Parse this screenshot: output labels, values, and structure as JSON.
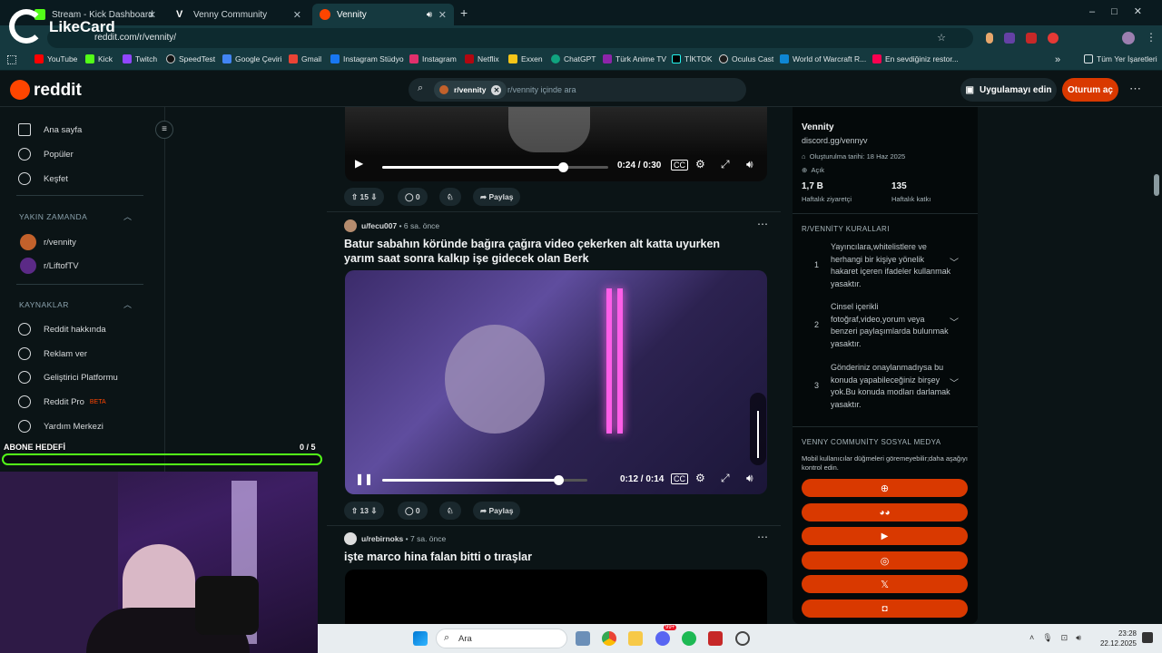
{
  "browser": {
    "tabs": [
      {
        "label": "Stream - Kick Dashboard",
        "color": "#53fc18"
      },
      {
        "label": "Venny Community",
        "color": "#ffffff"
      },
      {
        "label": "Vennity",
        "color": "#ff4500"
      }
    ],
    "url": "reddit.com/r/vennity/",
    "overlay_logo": "LikeCard",
    "bookmarks": [
      "YouTube",
      "Kick",
      "Twitch",
      "SpeedTest",
      "Google Çeviri",
      "Gmail",
      "Instagram Stüdyo",
      "Instagram",
      "Netflix",
      "Exxen",
      "ChatGPT",
      "Türk Anime TV",
      "TİKTOK",
      "Oculus Cast",
      "World of Warcraft R...",
      "En sevdiğiniz restor..."
    ],
    "bookmarks_folder": "Tüm Yer İşaretleri"
  },
  "reddit": {
    "logo": "reddit",
    "search_chip": "r/vennity",
    "search_placeholder": "r/vennity içinde ara",
    "get_app": "Uygulamayı edin",
    "login": "Oturum aç"
  },
  "leftnav": {
    "items": [
      "Ana sayfa",
      "Popüler",
      "Keşfet"
    ],
    "recent_title": "YAKIN ZAMANDA",
    "recent": [
      "r/vennity",
      "r/LiftofTV"
    ],
    "resources_title": "KAYNAKLAR",
    "resources": [
      "Reddit hakkında",
      "Reklam ver",
      "Geliştirici Platformu",
      "Reddit Pro",
      "Yardım Merkezi"
    ],
    "beta": "BETA"
  },
  "posts": [
    {
      "time": "0:24 / 0:30",
      "progress": 0.8,
      "votes": "15",
      "comments": "0",
      "share": "Paylaş"
    },
    {
      "author": "u/fecu007",
      "age": "6 sa. önce",
      "title": "Batur sabahın köründe bağıra çağıra video çekerken alt katta uyurken yarım saat sonra kalkıp işe gidecek olan Berk",
      "time": "0:12 / 0:14",
      "progress": 0.86,
      "votes": "13",
      "comments": "0",
      "share": "Paylaş"
    },
    {
      "author": "u/rebirnoks",
      "age": "7 sa. önce",
      "title": "işte marco hina falan bitti o tıraşlar"
    }
  ],
  "sidebar": {
    "name": "Vennity",
    "discord": "discord.gg/vennyv",
    "created": "Oluşturulma tarihi: 18 Haz 2025",
    "status": "Açık",
    "visitors": "1,7 B",
    "visitors_label": "Haftalık ziyaretçi",
    "contrib": "135",
    "contrib_label": "Haftalık katkı",
    "rules_title": "R/VENNİTY KURALLARI",
    "rules": [
      {
        "n": "1",
        "text": "Yayıncılara,whitelistlere ve herhangi bir kişiye yönelik hakaret içeren ifadeler kullanmak yasaktır."
      },
      {
        "n": "2",
        "text": "Cinsel içerikli fotoğraf,video,yorum veya benzeri paylaşımlarda bulunmak yasaktır."
      },
      {
        "n": "3",
        "text": "Gönderiniz onaylanmadıysa bu konuda yapabileceğiniz birşey yok.Bu konuda modları darlamak yasaktır."
      }
    ],
    "social_title": "VENNY COMMUNİTY SOSYAL MEDYA",
    "social_note": "Mobil kullanıcılar düğmeleri göremeyebilir;daha aşağıyı kontrol edin.",
    "social_icons": [
      "globe-icon",
      "discord-icon",
      "youtube-icon",
      "instagram-icon",
      "x-icon",
      "twitch-icon"
    ]
  },
  "stream_overlay": {
    "goal_label": "ABONE HEDEFİ",
    "goal_value": "0 / 5",
    "goal_progress": 0
  },
  "taskbar": {
    "search": "Ara",
    "time": "23:28",
    "date": "22.12.2025",
    "badge": "99+"
  }
}
